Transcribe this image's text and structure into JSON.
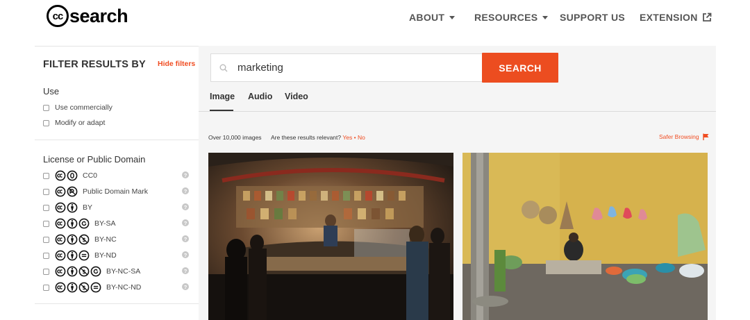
{
  "header": {
    "logo_cc": "cc",
    "logo_text": "search",
    "nav": {
      "about": "ABOUT",
      "resources": "RESOURCES",
      "support": "SUPPORT US",
      "extension": "EXTENSION"
    }
  },
  "sidebar": {
    "title": "FILTER RESULTS BY",
    "hide_filters": "Hide filters",
    "use": {
      "title": "Use",
      "options": [
        "Use commercially",
        "Modify or adapt"
      ]
    },
    "license": {
      "title": "License or Public Domain",
      "items": [
        {
          "label": "CC0",
          "icons": [
            "cc",
            "zero"
          ]
        },
        {
          "label": "Public Domain Mark",
          "icons": [
            "cc",
            "pd"
          ]
        },
        {
          "label": "BY",
          "icons": [
            "cc",
            "by"
          ]
        },
        {
          "label": "BY-SA",
          "icons": [
            "cc",
            "by",
            "sa"
          ]
        },
        {
          "label": "BY-NC",
          "icons": [
            "cc",
            "by",
            "nc"
          ]
        },
        {
          "label": "BY-ND",
          "icons": [
            "cc",
            "by",
            "nd"
          ]
        },
        {
          "label": "BY-NC-SA",
          "icons": [
            "cc",
            "by",
            "nc",
            "sa"
          ]
        },
        {
          "label": "BY-NC-ND",
          "icons": [
            "cc",
            "by",
            "nc",
            "nd"
          ]
        }
      ],
      "help": "?"
    }
  },
  "search": {
    "query": "marketing",
    "button": "SEARCH"
  },
  "tabs": [
    "Image",
    "Audio",
    "Video"
  ],
  "results": {
    "count": "Over 10,000 images",
    "relevance_question": "Are these results relevant?",
    "yes": "Yes",
    "sep": "•",
    "no": "No",
    "safer_browsing": "Safer Browsing"
  },
  "colors": {
    "accent": "#ec4d20",
    "panel_bg": "#f5f5f5"
  }
}
